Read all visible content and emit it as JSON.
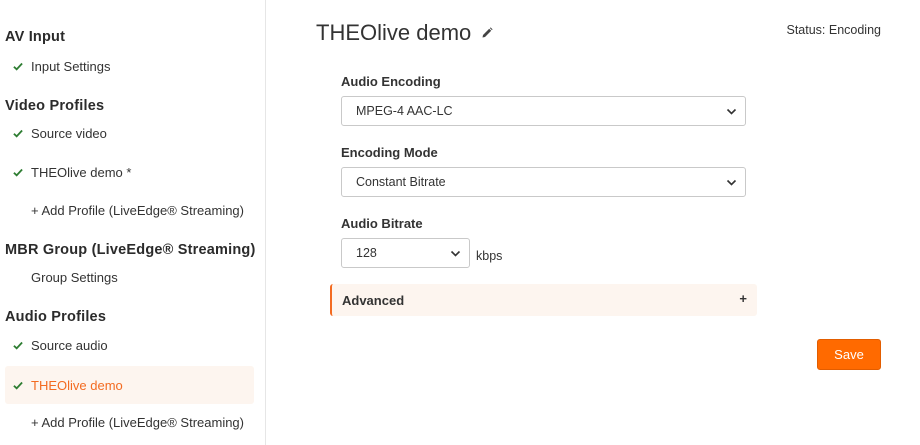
{
  "sidebar": {
    "sections": {
      "av_input": "AV Input",
      "video_profiles": "Video Profiles",
      "mbr_group": "MBR Group (LiveEdge® Streaming)",
      "audio_profiles": "Audio Profiles"
    },
    "items": {
      "input_settings": "Input Settings",
      "source_video": "Source video",
      "video_theolive_demo": "THEOlive demo *",
      "add_video_profile": "+ Add Profile (LiveEdge® Streaming)",
      "group_settings": "Group Settings",
      "source_audio": "Source audio",
      "audio_theolive_demo": "THEOlive demo",
      "add_audio_profile": "+ Add Profile (LiveEdge® Streaming)"
    },
    "active_item": "audio_theolive_demo"
  },
  "header": {
    "title": "THEOlive demo",
    "status": "Status: Encoding"
  },
  "form": {
    "audio_encoding": {
      "label": "Audio Encoding",
      "value": "MPEG-4 AAC-LC"
    },
    "encoding_mode": {
      "label": "Encoding Mode",
      "value": "Constant Bitrate"
    },
    "audio_bitrate": {
      "label": "Audio Bitrate",
      "value": "128",
      "unit": "kbps"
    },
    "advanced": {
      "label": "Advanced",
      "toggle": "+"
    },
    "save_label": "Save"
  },
  "colors": {
    "accent": "#f36b21",
    "check": "#2e7d32",
    "active_bg": "#fdf5ef",
    "save_bg": "#ff6a00"
  },
  "icons": {
    "check": "check-icon",
    "edit": "pencil-icon",
    "dropdown": "chevron-down-icon"
  }
}
